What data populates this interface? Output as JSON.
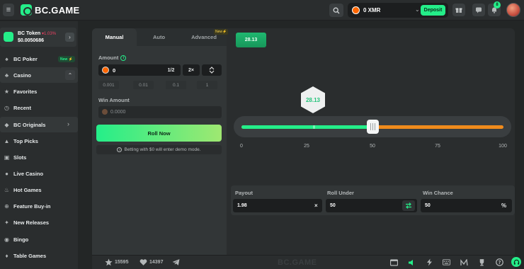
{
  "brand": {
    "name": "BC.GAME"
  },
  "topbar": {
    "wallet_amount": "0 XMR",
    "deposit_label": "Deposit",
    "notification_count": "8"
  },
  "sidebar": {
    "token": {
      "name": "BC Token",
      "change": "1.03%",
      "price": "$0.0050686"
    },
    "items": [
      {
        "label": "BC Poker",
        "badge": "New"
      },
      {
        "label": "Casino"
      },
      {
        "label": "Favorites"
      },
      {
        "label": "Recent"
      },
      {
        "label": "BC Originals"
      },
      {
        "label": "Top Picks"
      },
      {
        "label": "Slots"
      },
      {
        "label": "Live Casino"
      },
      {
        "label": "Hot Games"
      },
      {
        "label": "Feature Buy-in"
      },
      {
        "label": "New Releases"
      },
      {
        "label": "Bingo"
      },
      {
        "label": "Table Games"
      }
    ]
  },
  "game": {
    "tabs": [
      {
        "label": "Manual"
      },
      {
        "label": "Auto"
      },
      {
        "label": "Advanced",
        "badge": "New"
      }
    ],
    "amount_label": "Amount",
    "amount_value": "0",
    "half_label": "1/2",
    "double_label": "2×",
    "presets": [
      "0.001",
      "0.01",
      "0.1",
      "1"
    ],
    "win_amount_label": "Win Amount",
    "win_amount_value": "0.0000",
    "roll_button": "Roll Now",
    "demo_note": "Betting with $0 will enter demo mode.",
    "last_result": "28.13",
    "dice_value": "28.13",
    "slider_value": 50,
    "scale_labels": [
      "0",
      "25",
      "50",
      "75",
      "100"
    ],
    "payout_label": "Payout",
    "payout_value": "1.98",
    "payout_suffix": "×",
    "roll_under_label": "Roll Under",
    "roll_under_value": "50",
    "win_chance_label": "Win Chance",
    "win_chance_value": "50",
    "win_chance_suffix": "%"
  },
  "bottombar": {
    "favorites_count": "15595",
    "likes_count": "14397",
    "logo": "BC.GAME"
  },
  "colors": {
    "accent": "#24ee89",
    "slider_over": "#f08b1c",
    "background": "#232626"
  }
}
